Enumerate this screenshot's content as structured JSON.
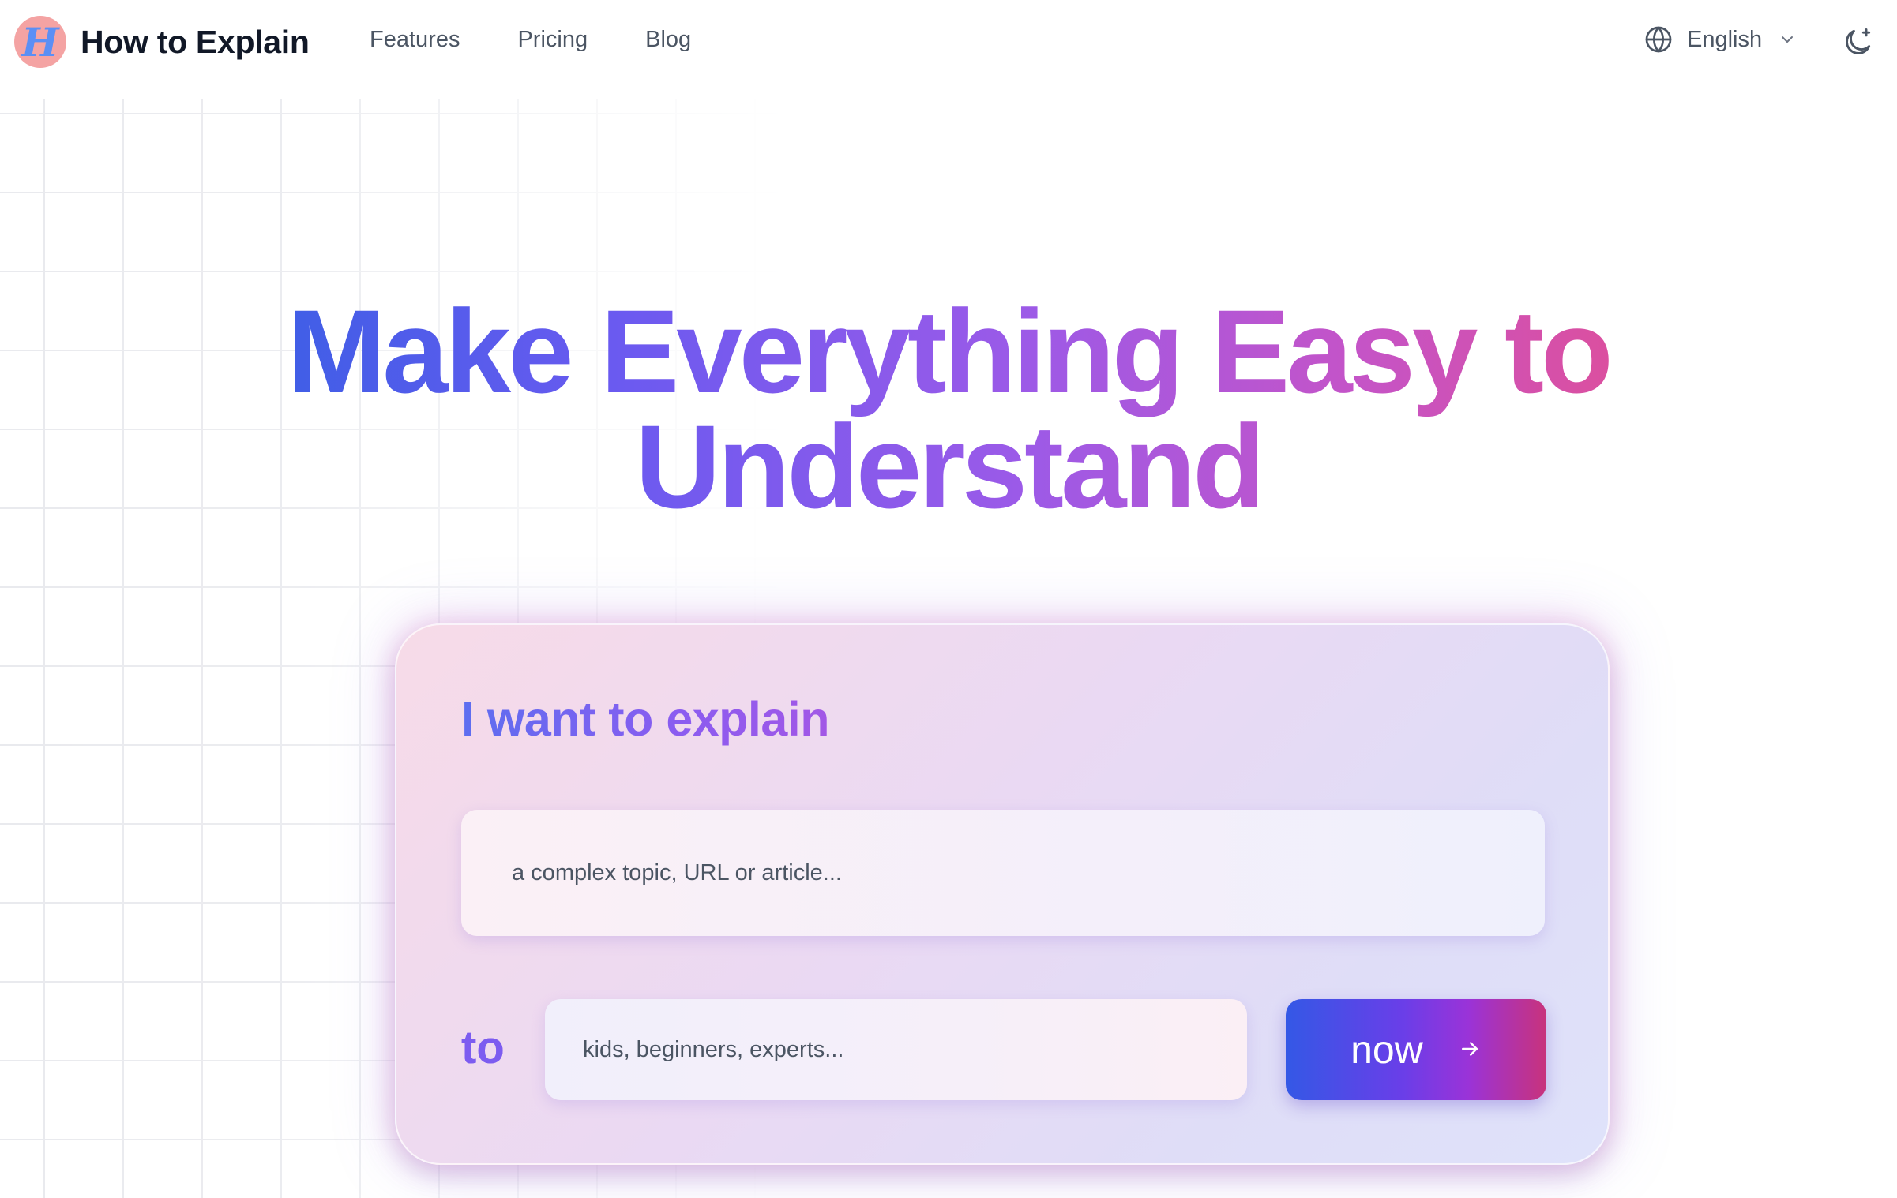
{
  "header": {
    "brand_letter": "H",
    "brand_name": "How to Explain",
    "nav": [
      "Features",
      "Pricing",
      "Blog"
    ],
    "language": "English",
    "icons": {
      "language": "globe-icon",
      "dropdown": "chevron-down-icon",
      "theme": "moon-sparkle-icon"
    }
  },
  "hero": {
    "title_line1": "Make Everything Easy to",
    "title_line2": "Understand"
  },
  "form": {
    "title": "I want to explain",
    "topic_placeholder": "a complex topic, URL or article...",
    "topic_value": "",
    "to_label": "to",
    "audience_placeholder": "kids, beginners, experts...",
    "audience_value": "",
    "submit_label": "now",
    "submit_icon": "arrow-right-icon"
  },
  "colors": {
    "gradient_start": "#3f5ee6",
    "gradient_mid": "#9b5ae8",
    "gradient_end": "#dc4f9e",
    "button_start": "#3458e6",
    "button_end": "#c8337c",
    "logo_bg": "#f4a3a3",
    "logo_letter": "#5b8ff5"
  }
}
